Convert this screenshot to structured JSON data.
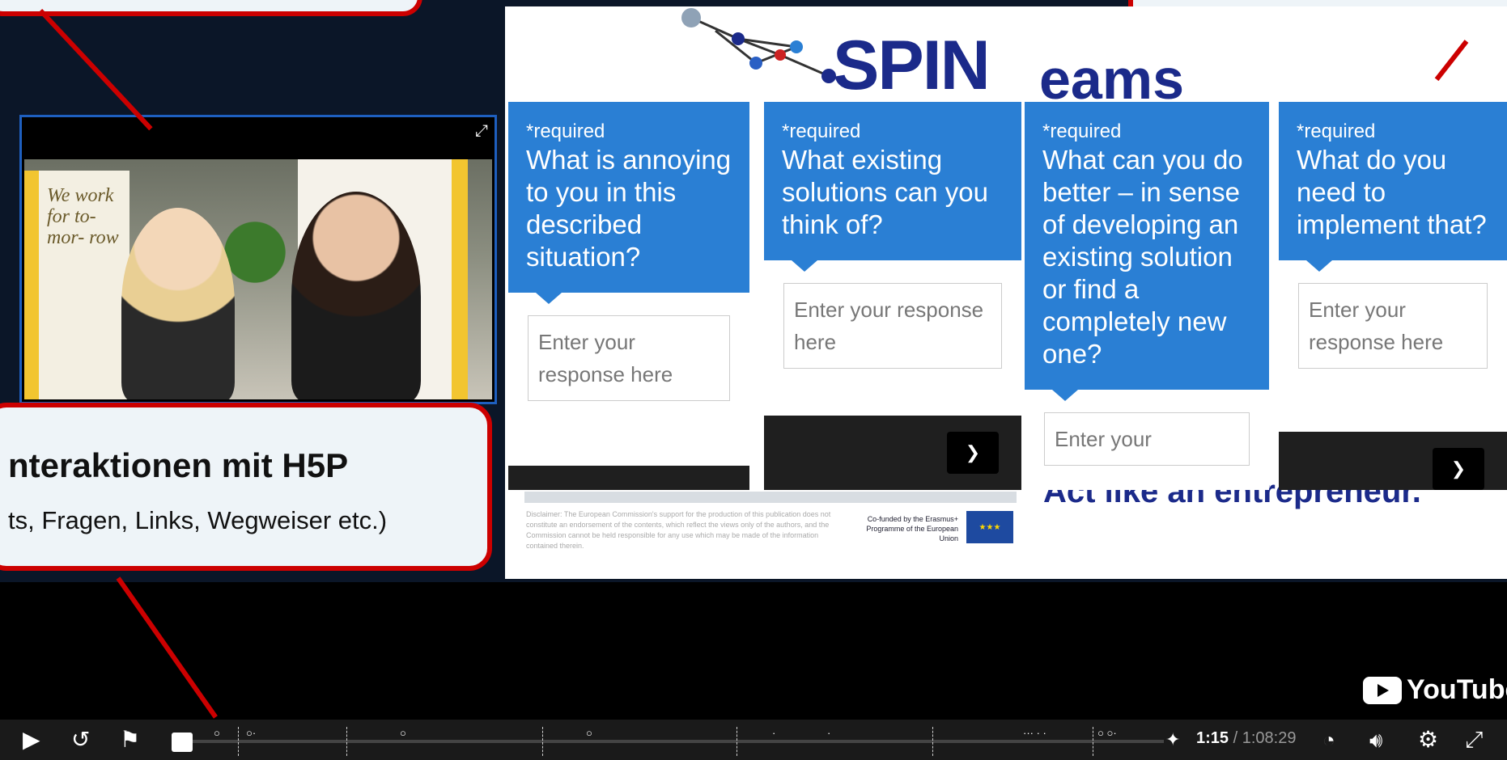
{
  "slide": {
    "logo_text": "SPIN",
    "logo_text_2": "eams",
    "footer_disclaimer": "Disclaimer: The European Commission's support for the production of this publication does not constitute an endorsement of the contents, which reflect the views only of the authors, and the Commission cannot be held responsible for any use which may be made of the information contained therein.",
    "cofunded": "Co-funded by the Erasmus+ Programme of the European Union",
    "act_text": "Act like an entrepreneur."
  },
  "cards": [
    {
      "required": "*required",
      "question": "What is annoying to you in this described situation?",
      "placeholder": "Enter your response here"
    },
    {
      "required": "*required",
      "question": "What existing solutions can you think of?",
      "placeholder": "Enter your response here"
    },
    {
      "required": "*required",
      "question": "What can you do better – in sense of developing an existing solution or find a completely new one?",
      "placeholder": "Enter your"
    },
    {
      "required": "*required",
      "question": "What do you need to implement that?",
      "placeholder": "Enter your response here"
    }
  ],
  "callout": {
    "title": "nteraktionen mit H5P",
    "subtitle": "ts, Fragen, Links, Wegweiser etc.)"
  },
  "video": {
    "banner_text": "We work for to- mor- row"
  },
  "youtube": {
    "label": "YouTube"
  },
  "player": {
    "current_time": "1:15",
    "duration": "/ 1:08:29"
  },
  "icons": {
    "play": "play-icon",
    "rewind": "rewind-10-icon",
    "bookmark": "bookmark-icon",
    "volume": "volume-icon",
    "speed": "speed-icon",
    "settings": "gear-icon",
    "fullscreen": "fullscreen-icon"
  },
  "colors": {
    "accent_blue": "#2a7fd4",
    "callout_red": "#cc0000"
  }
}
